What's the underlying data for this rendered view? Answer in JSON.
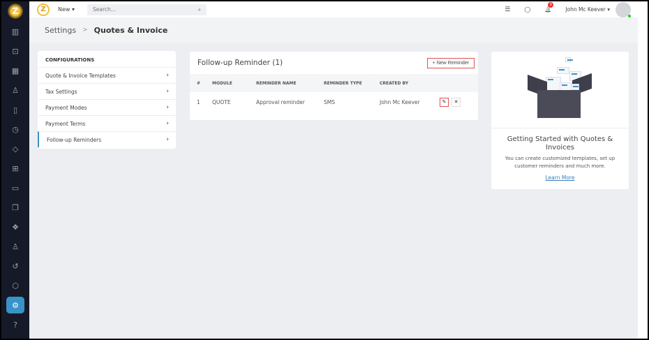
{
  "sidebar": {
    "logo": "Z",
    "items": [
      {
        "name": "reports",
        "glyph": "▥"
      },
      {
        "name": "briefcase",
        "glyph": "⊡"
      },
      {
        "name": "calendar",
        "glyph": "▦"
      },
      {
        "name": "contacts",
        "glyph": "♙"
      },
      {
        "name": "map",
        "glyph": "▯"
      },
      {
        "name": "clock",
        "glyph": "◷"
      },
      {
        "name": "tag",
        "glyph": "◇"
      },
      {
        "name": "dashboard",
        "glyph": "⊞"
      },
      {
        "name": "folder",
        "glyph": "▭"
      },
      {
        "name": "documents",
        "glyph": "❐"
      },
      {
        "name": "layers-app",
        "glyph": "❖"
      },
      {
        "name": "user",
        "glyph": "♙"
      },
      {
        "name": "history",
        "glyph": "↺"
      },
      {
        "name": "stack",
        "glyph": "⬡"
      },
      {
        "name": "settings",
        "glyph": "⚙",
        "active": true
      },
      {
        "name": "help",
        "glyph": "?"
      }
    ]
  },
  "topbar": {
    "logo": "Z",
    "new_label": "New ▾",
    "search_placeholder": "Search...",
    "search_icon": "⌕",
    "list_icon": "☰",
    "chat_icon": "◯",
    "bell_icon": "🔔",
    "notif_count": "0",
    "user_name": "John Mc Keever ▾"
  },
  "breadcrumb": {
    "parent": "Settings",
    "sep": ">",
    "current": "Quotes & Invoice"
  },
  "config": {
    "title": "CONFIGURATIONS",
    "items": [
      "Quote & Invoice Templates",
      "Tax Settings",
      "Payment Modes",
      "Payment Terms",
      "Follow-up Reminders"
    ],
    "active": "Follow-up Reminders",
    "chevron": "›"
  },
  "reminders": {
    "title": "Follow-up Reminder (1)",
    "new_button": "+ New Reminder",
    "columns": [
      "#",
      "MODULE",
      "REMINDER NAME",
      "REMINDER TYPE",
      "CREATED BY"
    ],
    "rows": [
      [
        "1",
        "QUOTE",
        "Approval reminder",
        "SMS",
        "John Mc Keever"
      ]
    ],
    "edit_icon": "✎",
    "delete_icon": "✕"
  },
  "info": {
    "title": "Getting Started with Quotes & Invoices",
    "text": "You can create customized templates, set up customer reminders and much more.",
    "link": "Learn More"
  },
  "colors": {
    "accent": "#3a93c8",
    "sidebar": "#161a28",
    "highlight": "#e05050"
  }
}
